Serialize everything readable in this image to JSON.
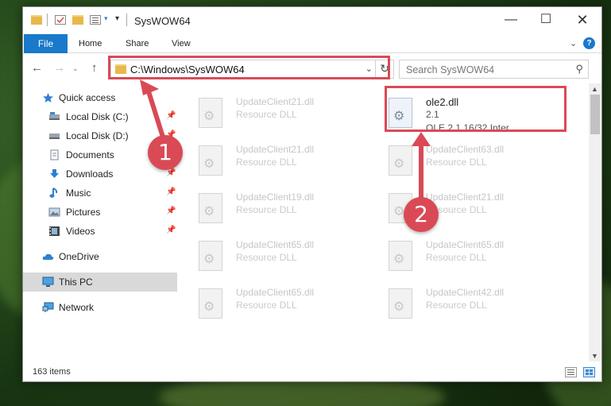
{
  "window": {
    "title": "SysWOW64"
  },
  "ribbon": {
    "tabs": [
      "File",
      "Home",
      "Share",
      "View"
    ]
  },
  "address": {
    "path": "C:\\Windows\\SysWOW64",
    "dropdown_glyph": "⌄",
    "refresh_glyph": "↻"
  },
  "search": {
    "placeholder": "Search SysWOW64"
  },
  "sidebar": {
    "items": [
      {
        "label": "Quick access",
        "icon": "star-icon",
        "pinned": false
      },
      {
        "label": "Local Disk (C:)",
        "icon": "drive-icon",
        "pinned": true
      },
      {
        "label": "Local Disk (D:)",
        "icon": "drive-icon",
        "pinned": true
      },
      {
        "label": "Documents",
        "icon": "documents-icon",
        "pinned": true
      },
      {
        "label": "Downloads",
        "icon": "download-icon",
        "pinned": true
      },
      {
        "label": "Music",
        "icon": "music-icon",
        "pinned": true
      },
      {
        "label": "Pictures",
        "icon": "pictures-icon",
        "pinned": true
      },
      {
        "label": "Videos",
        "icon": "videos-icon",
        "pinned": true
      },
      {
        "label": "OneDrive",
        "icon": "cloud-icon",
        "pinned": false
      },
      {
        "label": "This PC",
        "icon": "computer-icon",
        "pinned": false,
        "selected": true
      },
      {
        "label": "Network",
        "icon": "network-icon",
        "pinned": false
      }
    ]
  },
  "files": {
    "left_column": [
      {
        "name": "UpdateClient21.dll",
        "type": "Resource DLL"
      },
      {
        "name": "UpdateClient21.dll",
        "type": "Resource DLL"
      },
      {
        "name": "UpdateClient19.dll",
        "type": "Resource DLL"
      },
      {
        "name": "UpdateClient65.dll",
        "type": "Resource DLL"
      },
      {
        "name": "UpdateClient65.dll",
        "type": "Resource DLL"
      }
    ],
    "focused": {
      "name": "ole2.dll",
      "version": "2.1",
      "description": "OLE 2.1 16/32 Inter..."
    },
    "right_column": [
      {
        "name": "UpdateClient63.dll",
        "type": "Resource DLL"
      },
      {
        "name": "UpdateClient21.dll",
        "type": "Resource DLL"
      },
      {
        "name": "UpdateClient65.dll",
        "type": "Resource DLL"
      },
      {
        "name": "UpdateClient42.dll",
        "type": "Resource DLL"
      }
    ]
  },
  "status": {
    "item_count": "163 items"
  },
  "callouts": [
    "1",
    "2"
  ],
  "colors": {
    "accent": "#1979ca",
    "highlight": "#d94a56"
  }
}
